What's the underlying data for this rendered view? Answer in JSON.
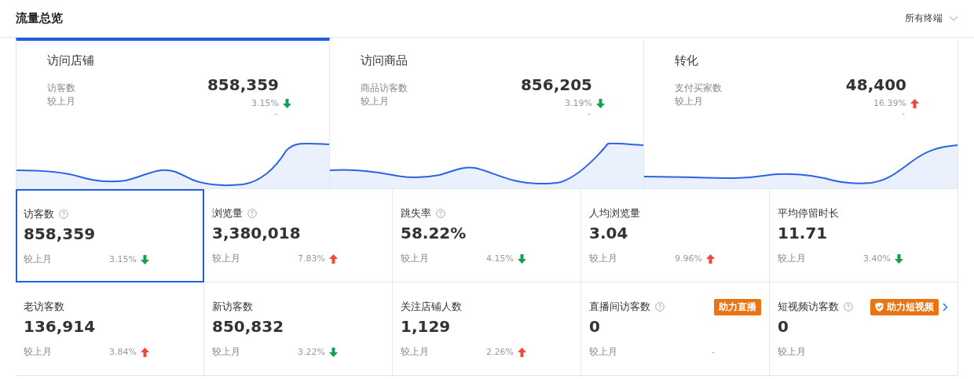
{
  "header": {
    "title": "流量总览",
    "filter": "所有终端"
  },
  "overview_cards": [
    {
      "title": "访问店铺",
      "metric": "访客数",
      "value": "858,359",
      "compare_label": "较上月",
      "change": "3.15%",
      "rising": false,
      "note": "-",
      "selected": true
    },
    {
      "title": "访问商品",
      "metric": "商品访客数",
      "value": "856,205",
      "compare_label": "较上月",
      "change": "3.19%",
      "rising": false,
      "note": "-",
      "selected": false
    },
    {
      "title": "转化",
      "metric": "支付买家数",
      "value": "48,400",
      "compare_label": "较上月",
      "change": "16.39%",
      "rising": true,
      "note": "-",
      "selected": false
    }
  ],
  "metrics": [
    {
      "label": "访客数",
      "help": true,
      "value": "858,359",
      "compare_label": "较上月",
      "change": "3.15%",
      "rising": false,
      "selected": true
    },
    {
      "label": "浏览量",
      "help": true,
      "value": "3,380,018",
      "compare_label": "较上月",
      "change": "7.83%",
      "rising": true,
      "selected": false
    },
    {
      "label": "跳失率",
      "help": true,
      "value": "58.22%",
      "compare_label": "较上月",
      "change": "4.15%",
      "rising": false,
      "selected": false
    },
    {
      "label": "人均浏览量",
      "help": false,
      "value": "3.04",
      "compare_label": "较上月",
      "change": "9.96%",
      "rising": true,
      "selected": false
    },
    {
      "label": "平均停留时长",
      "help": false,
      "value": "11.71",
      "compare_label": "较上月",
      "change": "3.40%",
      "rising": false,
      "selected": false
    },
    {
      "label": "老访客数",
      "help": false,
      "value": "136,914",
      "compare_label": "较上月",
      "change": "3.84%",
      "rising": true,
      "selected": false
    },
    {
      "label": "新访客数",
      "help": false,
      "value": "850,832",
      "compare_label": "较上月",
      "change": "3.22%",
      "rising": false,
      "selected": false
    },
    {
      "label": "关注店铺人数",
      "help": false,
      "value": "1,129",
      "compare_label": "较上月",
      "change": "2.26%",
      "rising": true,
      "selected": false
    },
    {
      "label": "直播间访客数",
      "help": true,
      "value": "0",
      "compare_label": "较上月",
      "change": "-",
      "selected": false,
      "badge": {
        "text": "助力直播",
        "kind": "plain"
      }
    },
    {
      "label": "短视频访客数",
      "help": true,
      "value": "0",
      "compare_label": "较上月",
      "selected": false,
      "badge": {
        "text": "助力短视频",
        "kind": "shield"
      },
      "more": true
    }
  ]
}
